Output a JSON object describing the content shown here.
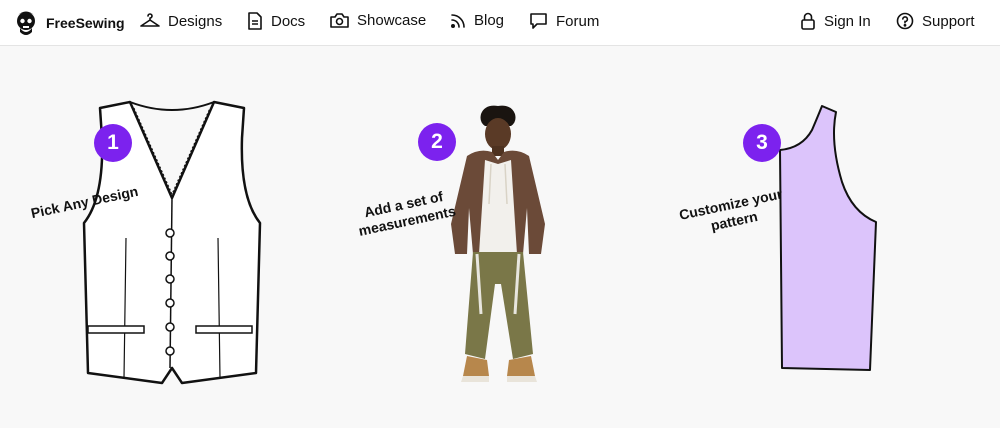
{
  "app": {
    "brand_name": "FreeSewing"
  },
  "nav": {
    "items": [
      {
        "label": "Designs",
        "icon": "hanger-icon"
      },
      {
        "label": "Docs",
        "icon": "document-icon"
      },
      {
        "label": "Showcase",
        "icon": "camera-icon"
      },
      {
        "label": "Blog",
        "icon": "rss-icon"
      },
      {
        "label": "Forum",
        "icon": "chat-bubble-icon"
      }
    ],
    "right_items": [
      {
        "label": "Sign In",
        "icon": "lock-icon"
      },
      {
        "label": "Support",
        "icon": "question-circle-icon"
      }
    ]
  },
  "steps": [
    {
      "number": "1",
      "line1": "Pick Any Design",
      "line2": "",
      "image": "vest-drawing"
    },
    {
      "number": "2",
      "line1": "Add a set of",
      "line2": "measurements",
      "image": "person-photo"
    },
    {
      "number": "3",
      "line1": "Customize your",
      "line2": "pattern",
      "image": "pattern-piece"
    }
  ],
  "colors": {
    "accent": "#7c22ee",
    "pattern_fill": "#dcc4fb",
    "background": "#f8f8f8"
  }
}
